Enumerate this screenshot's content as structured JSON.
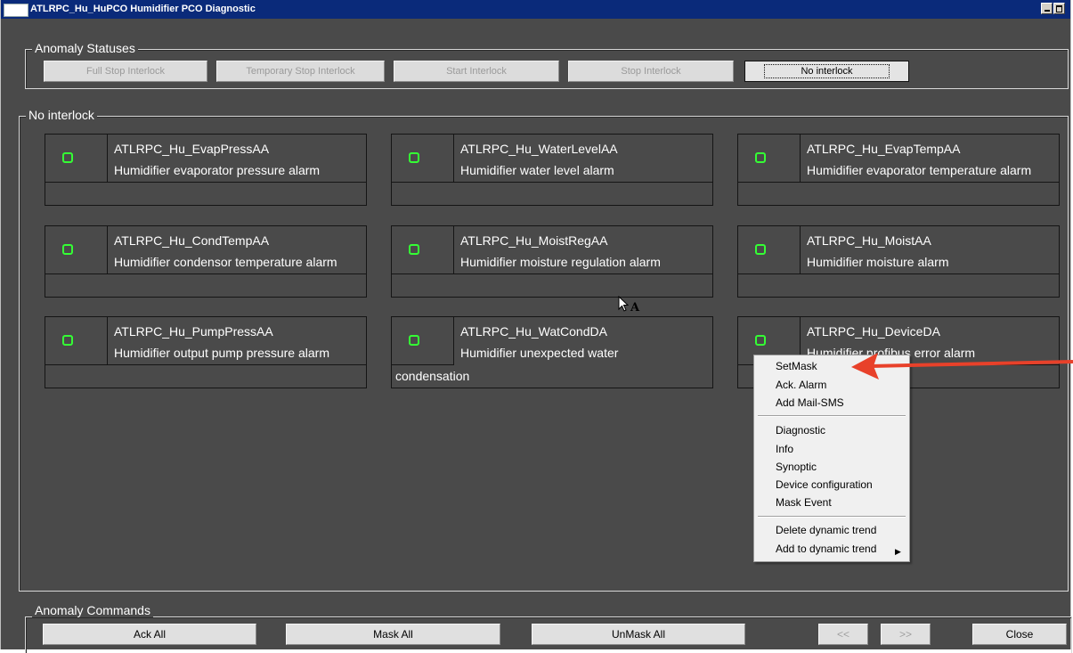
{
  "window": {
    "title": "ATLRPC_Hu_HuPCO Humidifier PCO Diagnostic"
  },
  "anomaly_statuses": {
    "label": "Anomaly Statuses",
    "buttons": [
      {
        "label": "Full Stop Interlock",
        "state": "disabled"
      },
      {
        "label": "Temporary Stop Interlock",
        "state": "disabled"
      },
      {
        "label": "Start Interlock",
        "state": "disabled"
      },
      {
        "label": "Stop Interlock",
        "state": "disabled"
      },
      {
        "label": "No interlock",
        "state": "active"
      }
    ]
  },
  "interlock_group": {
    "label": "No interlock"
  },
  "alarms": [
    {
      "name": "ATLRPC_Hu_EvapPressAA",
      "description": "Humidifier evaporator pressure alarm",
      "description_line2": ""
    },
    {
      "name": "ATLRPC_Hu_WaterLevelAA",
      "description": "Humidifier water level alarm",
      "description_line2": ""
    },
    {
      "name": "ATLRPC_Hu_EvapTempAA",
      "description": "Humidifier evaporator temperature alarm",
      "description_line2": ""
    },
    {
      "name": "ATLRPC_Hu_CondTempAA",
      "description": "Humidifier condensor temperature alarm",
      "description_line2": ""
    },
    {
      "name": "ATLRPC_Hu_MoistRegAA",
      "description": "Humidifier moisture regulation alarm",
      "description_line2": ""
    },
    {
      "name": "ATLRPC_Hu_MoistAA",
      "description": "Humidifier moisture alarm",
      "description_line2": ""
    },
    {
      "name": "ATLRPC_Hu_PumpPressAA",
      "description": "Humidifier output pump pressure alarm",
      "description_line2": ""
    },
    {
      "name": "ATLRPC_Hu_WatCondDA",
      "description": "Humidifier unexpected water",
      "description_line2": "condensation"
    },
    {
      "name": "ATLRPC_Hu_DeviceDA",
      "description": "Humidifier profibus error alarm",
      "description_line2": ""
    }
  ],
  "status_color": "#34ff34",
  "context_menu": {
    "items": [
      "SetMask",
      "Ack. Alarm",
      "Add Mail-SMS",
      "Diagnostic",
      "Info",
      "Synoptic",
      "Device configuration",
      "Mask Event",
      "Delete dynamic trend",
      "Add to dynamic trend"
    ],
    "submenu_icon": "submenu-arrow-icon"
  },
  "anomaly_commands": {
    "label": "Anomaly Commands",
    "buttons": [
      {
        "label": "Ack All",
        "state": "enabled"
      },
      {
        "label": "Mask All",
        "state": "enabled"
      },
      {
        "label": "UnMask All",
        "state": "enabled"
      },
      {
        "label": "<<",
        "state": "disabled"
      },
      {
        "label": ">>",
        "state": "disabled"
      },
      {
        "label": "Close",
        "state": "enabled"
      }
    ]
  },
  "cursor_label": "A",
  "annotation": {
    "color": "#e8412a",
    "icon": "red-arrow-icon"
  }
}
